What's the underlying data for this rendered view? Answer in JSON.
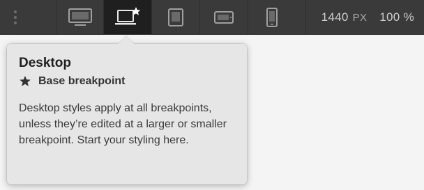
{
  "toolbar": {
    "breakpoints": [
      {
        "icon": "desktop-icon",
        "active": false
      },
      {
        "icon": "laptop-star-icon",
        "active": true
      },
      {
        "icon": "tablet-icon",
        "active": false
      },
      {
        "icon": "tablet-landscape-icon",
        "active": false
      },
      {
        "icon": "phone-icon",
        "active": false
      }
    ],
    "width_value": "1440",
    "width_unit": "PX",
    "zoom": "100 %"
  },
  "popover": {
    "title": "Desktop",
    "subtitle": "Base breakpoint",
    "subtitle_icon": "star-icon",
    "body": "Desktop styles apply at all breakpoints, unless they’re edited at a larger or smaller breakpoint. Start your styling here."
  },
  "colors": {
    "toolbar_bg": "#3a3a3a",
    "active_bg": "#1f1f1f",
    "popover_bg": "#e6e6e6"
  }
}
